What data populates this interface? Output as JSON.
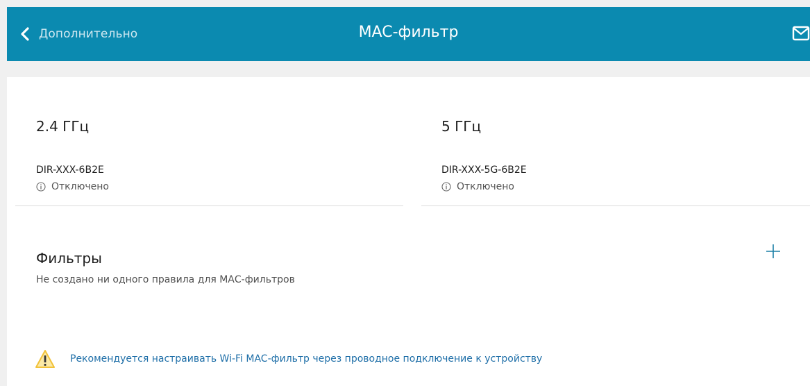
{
  "header": {
    "back_label": "Дополнительно",
    "title": "MAC-фильтр",
    "accent_color": "#0b8ab0"
  },
  "bands": [
    {
      "title": "2.4 ГГц",
      "ssid": "DIR-XXX-6B2E",
      "status": "Отключено"
    },
    {
      "title": "5 ГГц",
      "ssid": "DIR-XXX-5G-6B2E",
      "status": "Отключено"
    }
  ],
  "filters": {
    "title": "Фильтры",
    "empty_text": "Не создано ни одного правила для МАС-фильтров"
  },
  "warning": {
    "text": "Рекомендуется настраивать Wi-Fi MAC-фильтр через проводное подключение к устройству",
    "icon_color": "#f2c23a"
  },
  "icons": {
    "back": "chevron-left-icon",
    "mail": "mail-icon",
    "info": "info-icon",
    "add": "plus-icon",
    "warning": "warning-icon"
  }
}
